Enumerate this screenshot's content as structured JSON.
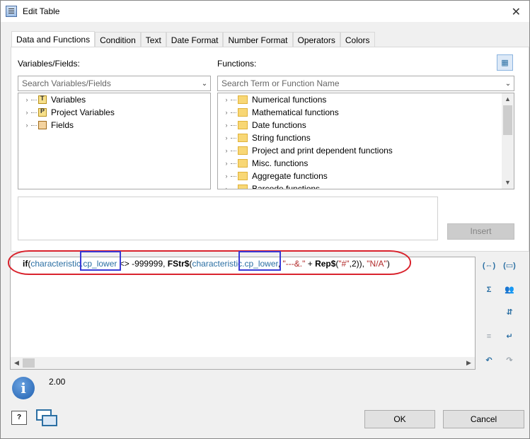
{
  "window": {
    "title": "Edit Table"
  },
  "tabs": [
    "Data and Functions",
    "Condition",
    "Text",
    "Date Format",
    "Number Format",
    "Operators",
    "Colors"
  ],
  "variables": {
    "label": "Variables/Fields:",
    "search_placeholder": "Search Variables/Fields",
    "items": [
      "Variables",
      "Project Variables",
      "Fields"
    ]
  },
  "functions": {
    "label": "Functions:",
    "search_placeholder": "Search Term or Function Name",
    "items": [
      "Numerical functions",
      "Mathematical functions",
      "Date functions",
      "String functions",
      "Project and print dependent functions",
      "Misc. functions",
      "Aggregate functions",
      "Barcode functions"
    ]
  },
  "insert_label": "Insert",
  "expression": {
    "t1": "if",
    "t2": "(",
    "t3": "characteristic",
    "t4": ".cp_lower",
    "t5": " <> -999999, ",
    "t6": "FStr$",
    "t7": "(",
    "t8": "characteristic",
    "t9": ".cp_lower",
    "t10": ", ",
    "t11": "\"---&.\"",
    "t12": " + ",
    "t13": "Rep$",
    "t14": "(",
    "t15": "\"#\"",
    "t16": ",2)), ",
    "t17": "\"N/A\"",
    "t18": ")"
  },
  "result_value": "2.00",
  "buttons": {
    "ok": "OK",
    "cancel": "Cancel"
  },
  "colors": {
    "accent": "#2b6fa3",
    "highlight_red": "#d9232d",
    "highlight_blue": "#3a3ad6"
  }
}
